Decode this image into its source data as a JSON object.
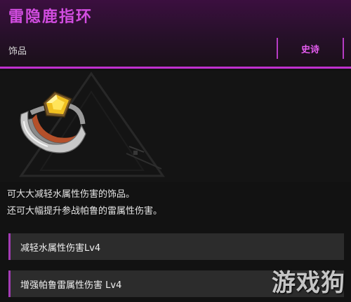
{
  "item": {
    "name": "雷隐鹿指环",
    "category": "饰品",
    "rarity": "史诗"
  },
  "description": {
    "line1": "可大大减轻水属性伤害的饰品。",
    "line2": "还可大幅提升参战帕鲁的雷属性伤害。"
  },
  "stats": [
    {
      "label": "减轻水属性伤害Lv4"
    },
    {
      "label": "增强帕鲁雷属性伤害 Lv4"
    }
  ],
  "watermark": "游戏狗",
  "colors": {
    "accent": "#c030d0",
    "title": "#d24de0",
    "panel": "#2c2c2c",
    "background": "#121212"
  }
}
